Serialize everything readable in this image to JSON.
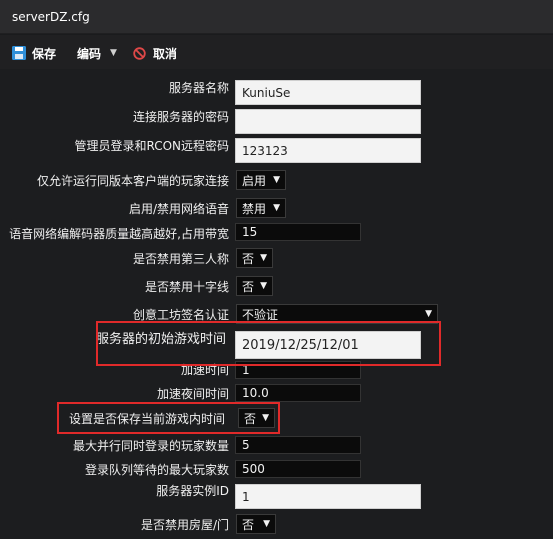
{
  "window": {
    "title": "serverDZ.cfg"
  },
  "toolbar": {
    "save_label": "保存",
    "encode_label": "编码",
    "cancel_label": "取消"
  },
  "fields": {
    "server_name": {
      "label": "服务器名称",
      "value": "KuniuSe"
    },
    "server_password": {
      "label": "连接服务器的密码",
      "value": ""
    },
    "admin_password": {
      "label": "管理员登录和RCON远程密码",
      "value": "123123"
    },
    "version_check": {
      "label": "仅允许运行同版本客户端的玩家连接",
      "value": "启用"
    },
    "voice": {
      "label": "启用/禁用网络语音",
      "value": "禁用"
    },
    "voice_quality": {
      "label": "语音网络编解码器质量越高越好,占用带宽",
      "value": "15"
    },
    "third_person": {
      "label": "是否禁用第三人称",
      "value": "否"
    },
    "crosshair": {
      "label": "是否禁用十字线",
      "value": "否"
    },
    "workshop_sig": {
      "label": "创意工坊签名认证",
      "value": "不验证"
    },
    "server_time": {
      "label": "服务器的初始游戏时间",
      "value": "2019/12/25/12/01"
    },
    "time_accel": {
      "label": "加速时间",
      "value": "1"
    },
    "night_accel": {
      "label": "加速夜间时间",
      "value": "10.0"
    },
    "persist_time": {
      "label": "设置是否保存当前游戏内时间",
      "value": "否"
    },
    "max_login": {
      "label": "最大并行同时登录的玩家数量",
      "value": "5"
    },
    "max_queue": {
      "label": "登录队列等待的最大玩家数",
      "value": "500"
    },
    "instance_id": {
      "label": "服务器实例ID",
      "value": "1"
    },
    "disable_base": {
      "label": "是否禁用房屋/门",
      "value": "否"
    }
  },
  "colors": {
    "highlight": "#e02a2a",
    "background": "#1c1d1f",
    "toolbar": "#202022"
  },
  "icons": {
    "save": "floppy-disk-icon",
    "encode_menu": "chevron-down-icon",
    "cancel": "no-entry-icon",
    "select": "triangle-down-icon"
  }
}
